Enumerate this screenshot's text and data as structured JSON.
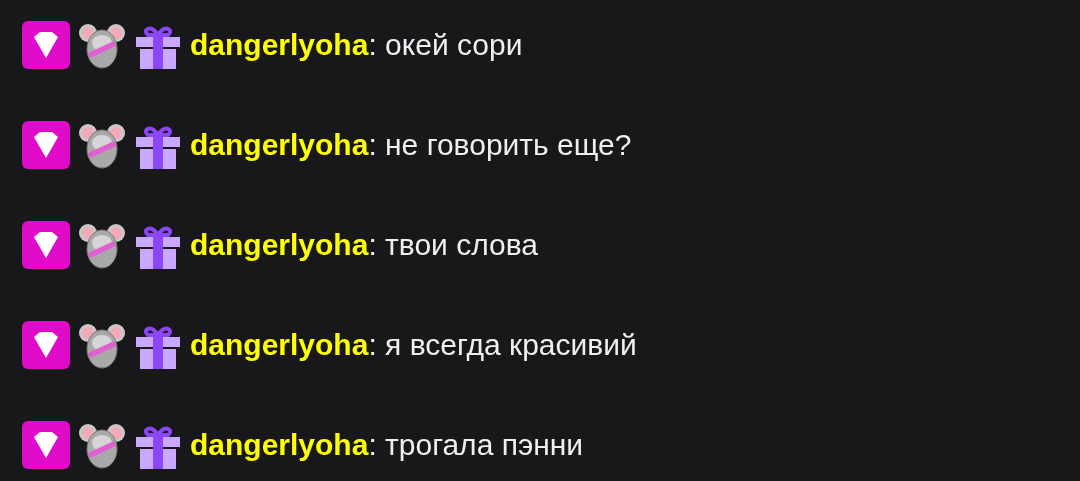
{
  "messages": [
    {
      "username": "dangerlyoha",
      "separator": ":",
      "text": "окей сори"
    },
    {
      "username": "dangerlyoha",
      "separator": ":",
      "text": "не говорить еще?"
    },
    {
      "username": "dangerlyoha",
      "separator": ":",
      "text": "твои слова"
    },
    {
      "username": "dangerlyoha",
      "separator": ":",
      "text": "я всегда красивий"
    },
    {
      "username": "dangerlyoha",
      "separator": ":",
      "text": "трогала пэнни"
    }
  ]
}
